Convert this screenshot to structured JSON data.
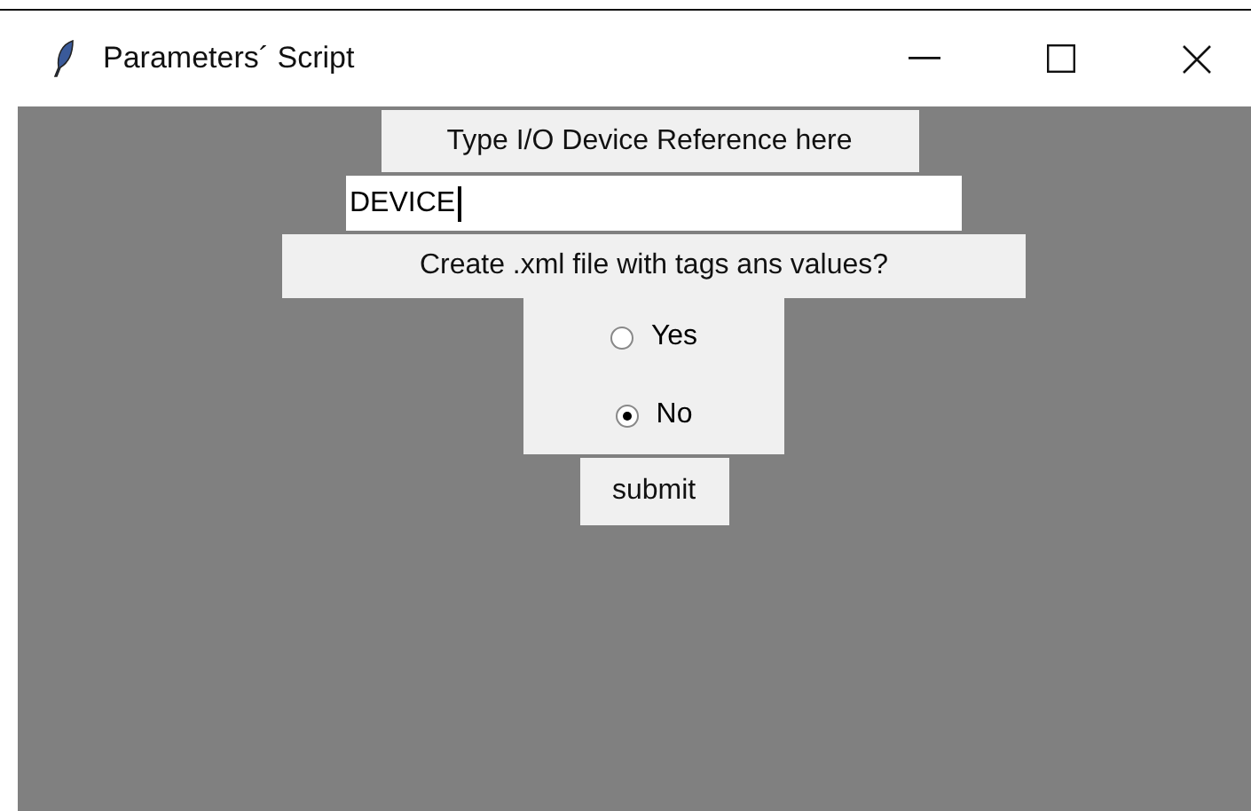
{
  "window": {
    "title": "Parameters´ Script"
  },
  "prompt_label": "Type I/O Device Reference here",
  "device_field": {
    "value": "DEVICE"
  },
  "question_label": "Create .xml file with tags ans values?",
  "options": [
    {
      "label": "Yes",
      "selected": false
    },
    {
      "label": "No",
      "selected": true
    }
  ],
  "submit_button": "submit"
}
